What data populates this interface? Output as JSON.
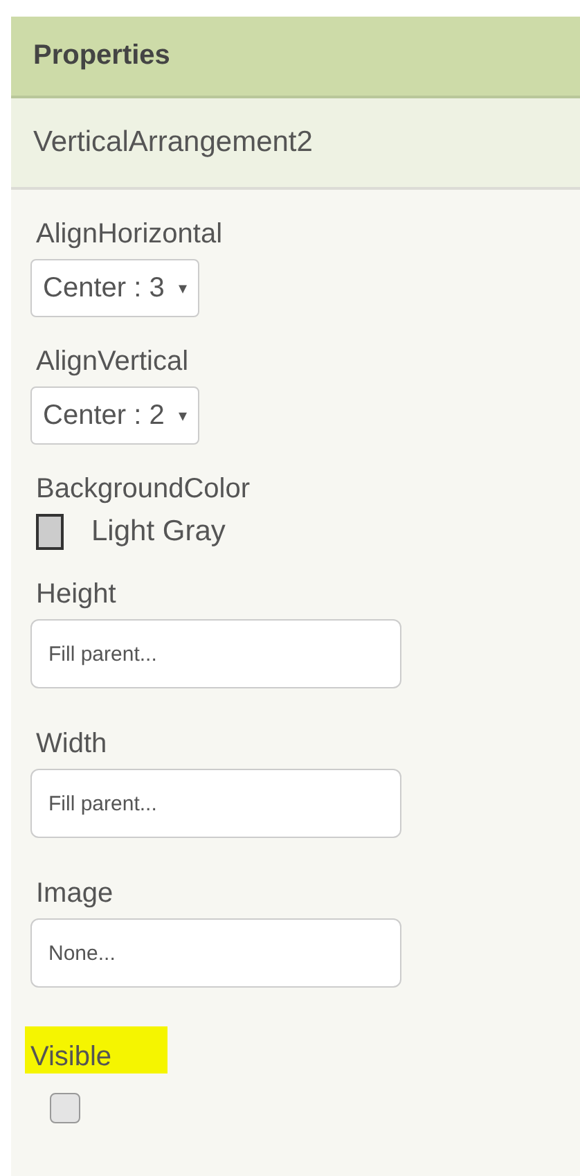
{
  "panel": {
    "title": "Properties",
    "component": "VerticalArrangement2"
  },
  "properties": [
    {
      "kind": "dropdown",
      "label": "AlignHorizontal",
      "value": "Center : 3",
      "caret": "▾",
      "highlighted": false
    },
    {
      "kind": "dropdown",
      "label": "AlignVertical",
      "value": "Center : 2",
      "caret": "▾",
      "highlighted": false
    },
    {
      "kind": "color",
      "label": "BackgroundColor",
      "value": "Light Gray",
      "color": "#cccccc",
      "highlighted": false
    },
    {
      "kind": "textbox",
      "label": "Height",
      "value": "Fill parent...",
      "highlighted": false
    },
    {
      "kind": "textbox",
      "label": "Width",
      "value": "Fill parent...",
      "highlighted": false
    },
    {
      "kind": "textbox",
      "label": "Image",
      "value": "None...",
      "highlighted": false
    },
    {
      "kind": "checkbox",
      "label": "Visible",
      "checked": false,
      "highlighted": true
    }
  ]
}
